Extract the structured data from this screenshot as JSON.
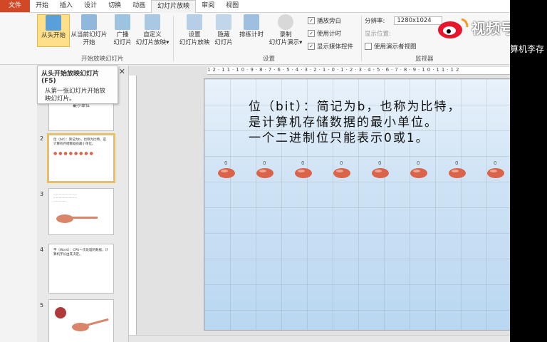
{
  "menubar": {
    "file": "文件",
    "items": [
      "开始",
      "插入",
      "设计",
      "切换",
      "动画",
      "幻灯片放映",
      "审阅",
      "视图"
    ],
    "active_index": 5
  },
  "ribbon": {
    "buttons": [
      {
        "label": "从头开始",
        "icon": "play-from-start-icon"
      },
      {
        "label": "从当前幻灯片\n开始",
        "icon": "play-from-current-icon"
      },
      {
        "label": "广播\n幻灯片",
        "icon": "broadcast-icon"
      },
      {
        "label": "自定义\n幻灯片放映▾",
        "icon": "custom-show-icon"
      },
      {
        "label": "设置\n幻灯片放映",
        "icon": "setup-show-icon"
      },
      {
        "label": "隐藏\n幻灯片",
        "icon": "hide-slide-icon"
      },
      {
        "label": "排练计时",
        "icon": "rehearse-icon"
      },
      {
        "label": "录制\n幻灯片演示▾",
        "icon": "record-icon"
      }
    ],
    "checks": [
      {
        "label": "播放旁白",
        "checked": true
      },
      {
        "label": "使用计时",
        "checked": true
      },
      {
        "label": "显示媒体控件",
        "checked": true
      }
    ],
    "monitor": {
      "resolution_label": "分辨率:",
      "resolution_value": "1280x1024",
      "display_label": "显示位置:",
      "presenter_label": "使用演示者视图"
    },
    "groups": [
      "开始放映幻灯片",
      "设置",
      "监视器"
    ]
  },
  "tooltip": {
    "title": "从头开始放映幻灯片 (F5)",
    "body": "从第一张幻灯片开始放映幻灯片。"
  },
  "panel": {
    "close": "✕",
    "slide_numbers": [
      "2",
      "3",
      "4",
      "5"
    ],
    "thumb1_title": "最小单位",
    "thumb2_text": "位（bit）：简记为b，也称为比特，是计算机存储数据的最小单位。",
    "thumb4_text": "字（Word）：CPU一次处理的数据，计算机字长由其决定。"
  },
  "ruler": "12·11·10·9·8·7·6·5·4·3·2·1·0·1·2·3·4·5·6·7·8·9·10·11·12",
  "slide": {
    "line1": "位（bit）：简记为b，也称为比特，",
    "line2": "是计算机存储数据的最小单位。",
    "line3": "一个二进制位只能表示0或1。",
    "bit_values": [
      "0",
      "0",
      "0",
      "0",
      "0",
      "0",
      "0",
      "0"
    ]
  },
  "watermark": {
    "line1": "视频号",
    "line2": "算机李存"
  },
  "colors": {
    "file_tab": "#d24726",
    "hot_button": "#ffe08a",
    "seed": "#d9644a"
  }
}
